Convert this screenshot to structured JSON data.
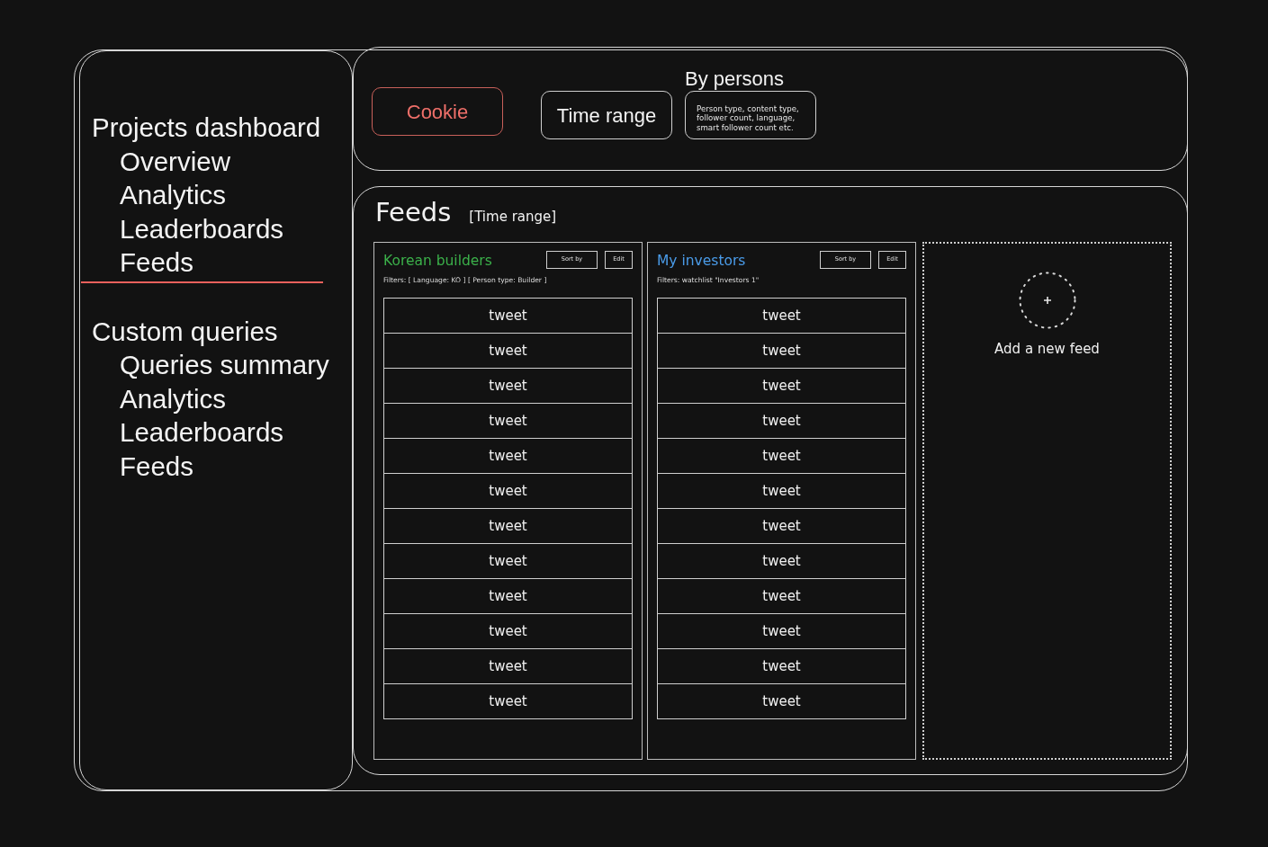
{
  "sidebar": {
    "groups": [
      {
        "title": "Projects dashboard",
        "selected": true,
        "items": [
          {
            "label": "Overview"
          },
          {
            "label": "Analytics"
          },
          {
            "label": "Leaderboards"
          },
          {
            "label": "Feeds"
          }
        ]
      },
      {
        "title": "Custom queries",
        "selected": false,
        "items": [
          {
            "label": "Queries summary"
          },
          {
            "label": "Analytics"
          },
          {
            "label": "Leaderboards"
          },
          {
            "label": "Feeds"
          }
        ]
      }
    ]
  },
  "toolbar": {
    "controls": [
      {
        "kind": "button",
        "label": "Cookie",
        "highlighted": true
      },
      {
        "kind": "button",
        "label": "Time range",
        "highlighted": false
      },
      {
        "kind": "filter_box",
        "heading": "By persons",
        "description": "Person type, content type, follower count, language, smart follower count etc."
      }
    ]
  },
  "feeds": {
    "title": "Feeds",
    "time_range": "[Time range]",
    "columns": [
      {
        "kind": "feed",
        "name": "Korean builders",
        "color": "#3bb04a",
        "sort_label": "Sort by",
        "edit_label": "Edit",
        "filters": "Filters: [ Language: KO ] [ Person type: Builder ]",
        "tweets": [
          "tweet",
          "tweet",
          "tweet",
          "tweet",
          "tweet",
          "tweet",
          "tweet",
          "tweet",
          "tweet",
          "tweet",
          "tweet",
          "tweet"
        ]
      },
      {
        "kind": "feed",
        "name": "My investors",
        "color": "#4a9be8",
        "sort_label": "Sort by",
        "edit_label": "Edit",
        "filters": "Filters: watchlist \"Investors 1\"",
        "tweets": [
          "tweet",
          "tweet",
          "tweet",
          "tweet",
          "tweet",
          "tweet",
          "tweet",
          "tweet",
          "tweet",
          "tweet",
          "tweet",
          "tweet"
        ]
      },
      {
        "kind": "add_feed",
        "label": "Add a new feed"
      }
    ]
  }
}
